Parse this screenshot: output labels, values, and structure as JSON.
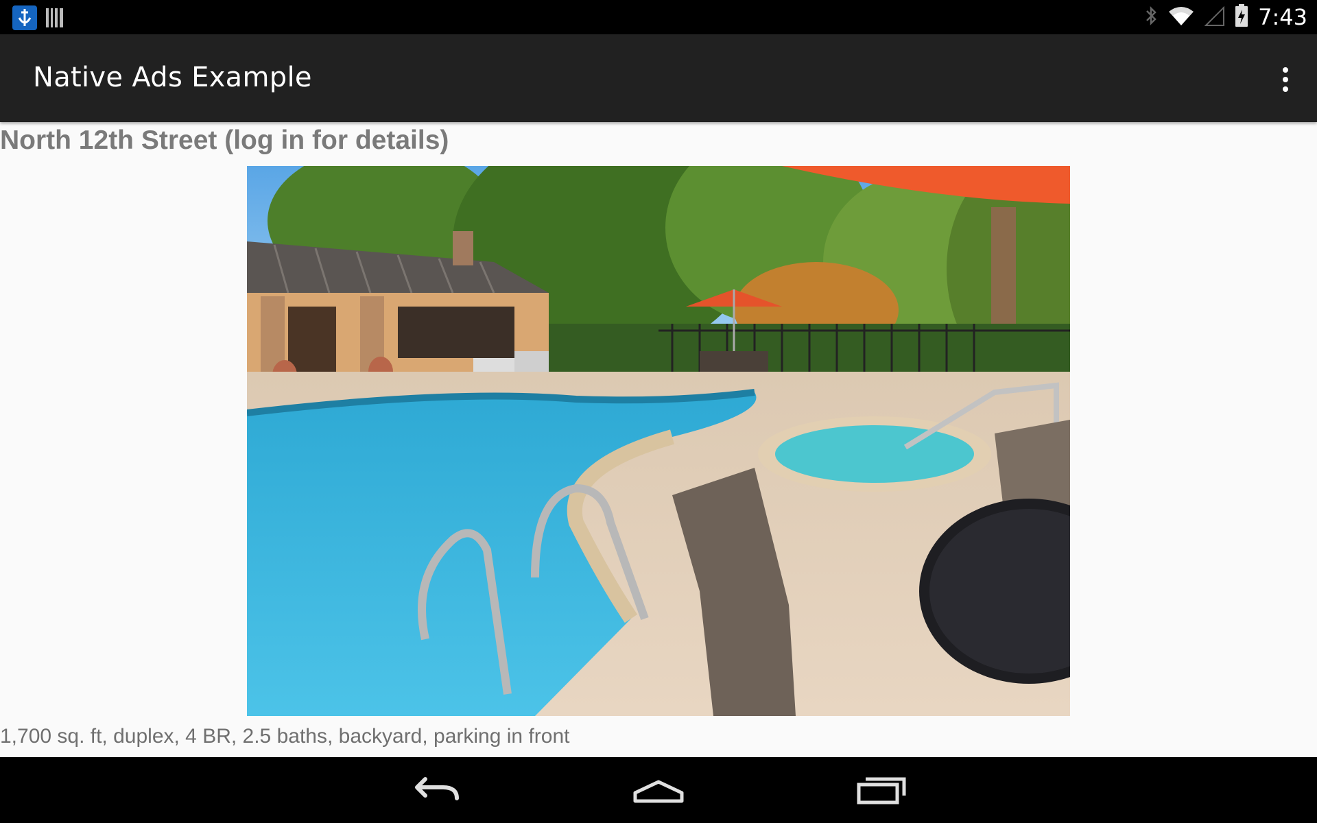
{
  "status_bar": {
    "time": "7:43",
    "left_icons": [
      "app-notification-icon",
      "barcode-notification-icon"
    ],
    "right_icons": [
      "bluetooth-icon",
      "wifi-icon",
      "cell-signal-icon",
      "battery-charging-icon"
    ]
  },
  "action_bar": {
    "title": "Native Ads Example",
    "overflow_icon": "more-vert-icon"
  },
  "listing": {
    "title": "North 12th Street (log in for details)",
    "description": "1,700 sq. ft, duplex, 4 BR, 2.5 baths, backyard, parking in front"
  },
  "nav_bar": {
    "buttons": [
      "back-icon",
      "home-icon",
      "recent-apps-icon"
    ]
  },
  "colors": {
    "status_bar": "#000000",
    "action_bar": "#212121",
    "background": "#fafafa",
    "title_text": "#7a7a7a",
    "body_text": "#6f6f6f"
  }
}
